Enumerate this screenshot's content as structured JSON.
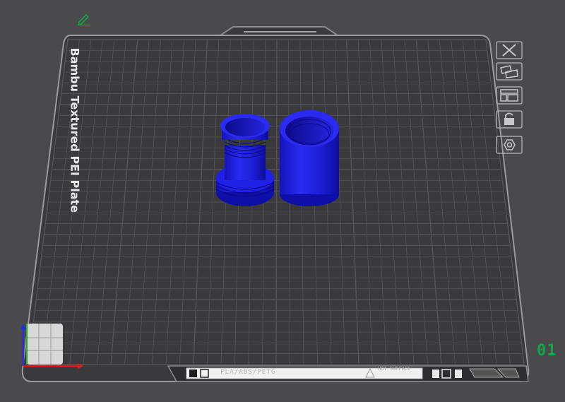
{
  "plate": {
    "name_label": "Bambu Textured PEI Plate",
    "filament_label": "PLA/ABS/PETG",
    "hot_surface_label": "HOT SURFACE",
    "plate_number": "01"
  },
  "colors": {
    "background": "#4a4a4c",
    "plate": "#3a3a3c",
    "grid": "#555558",
    "model": "#1f1fe0",
    "accent": "#13a54a"
  },
  "plate_toolbar": [
    {
      "name": "delete-plate-button",
      "icon": "close-icon"
    },
    {
      "name": "auto-arrange-button",
      "icon": "arrange-icon"
    },
    {
      "name": "plate-settings-button",
      "icon": "layout-icon"
    },
    {
      "name": "lock-plate-button",
      "icon": "lock-icon"
    },
    {
      "name": "plate-params-button",
      "icon": "gear-icon"
    }
  ],
  "objects": [
    {
      "name": "threaded-core-model"
    },
    {
      "name": "threaded-cap-model"
    }
  ]
}
